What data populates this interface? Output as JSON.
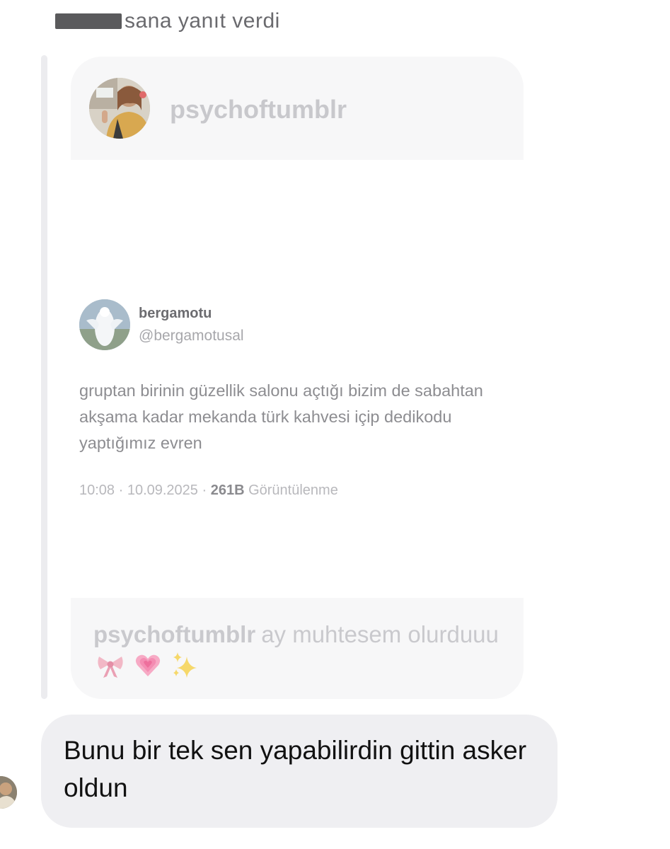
{
  "reply_header": {
    "text": "sana yanıt verdi"
  },
  "story": {
    "username": "psychoftumblr",
    "caption_user": "psychoftumblr",
    "caption_text": "ay muhtesem olurduuu",
    "emojis": [
      "ribbon-emoji",
      "growing-heart-emoji",
      "sparkles-emoji"
    ]
  },
  "tweet": {
    "name": "bergamotu",
    "handle": "@bergamotusal",
    "text": "gruptan birinin güzellik salonu açtığı bizim de sabahtan akşama kadar mekanda türk kahvesi içip dedikodu yaptığımız evren",
    "time": "10:08 · 10.09.2025 · ",
    "views_count": "261B",
    "views_label": " Görüntülenme"
  },
  "message": {
    "text": "Bunu bir tek sen yapabilirdin gittin asker oldun"
  }
}
